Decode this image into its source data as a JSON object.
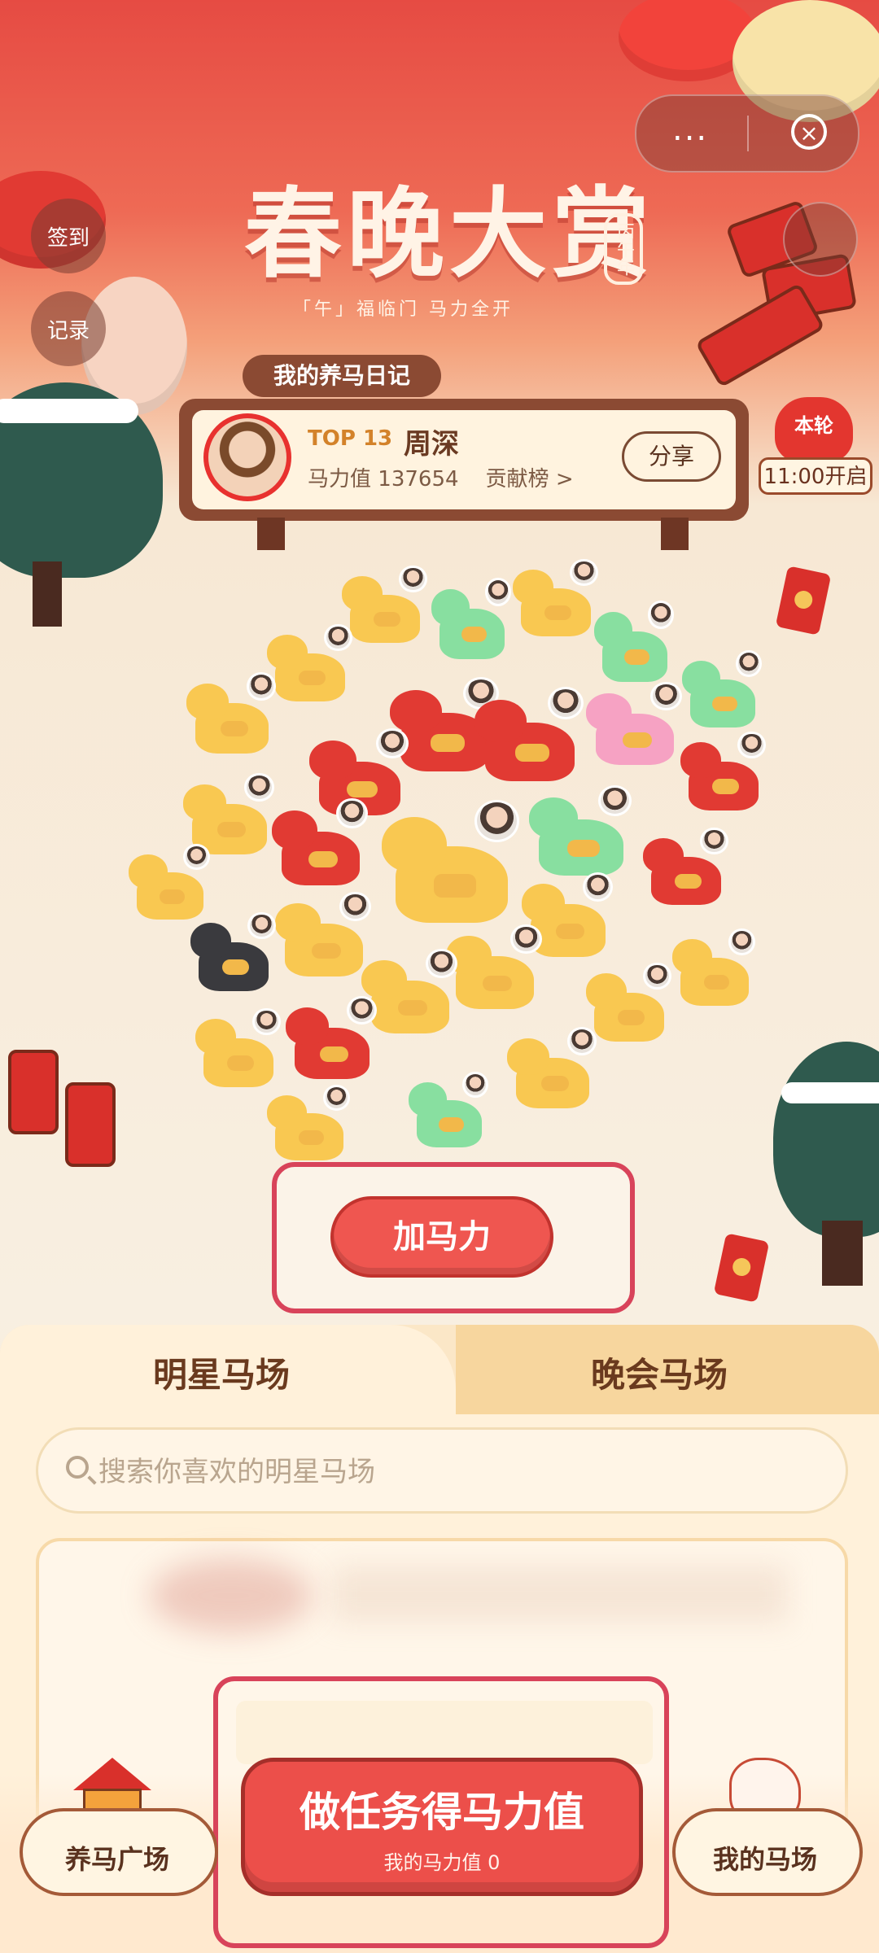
{
  "header": {
    "title": "春晚大赏",
    "year_badge": "丙午年",
    "subtitle": "「午」福临门  马力全开",
    "more_icon": "...",
    "close_icon": "×"
  },
  "side_buttons": {
    "checkin": "签到",
    "record": "记录"
  },
  "diary": {
    "label": "我的养马日记",
    "top_badge": "TOP",
    "rank": "13",
    "name": "周深",
    "power_label": "马力值",
    "power_value": "137654",
    "contribution": "贡献榜 >",
    "share": "分享"
  },
  "round": {
    "title": "本轮",
    "time": "11:00开启"
  },
  "add_power": "加马力",
  "tabs": {
    "star": "明星马场",
    "gala": "晚会马场"
  },
  "search": {
    "placeholder": "搜索你喜欢的明星马场"
  },
  "bottom_nav": {
    "square": "养马广场",
    "my_farm": "我的马场",
    "task_main": "做任务得马力值",
    "task_sub": "我的马力值 0"
  },
  "colors": {
    "accent_red": "#ef5650",
    "brown": "#8b4a33",
    "cream": "#fff1da"
  }
}
